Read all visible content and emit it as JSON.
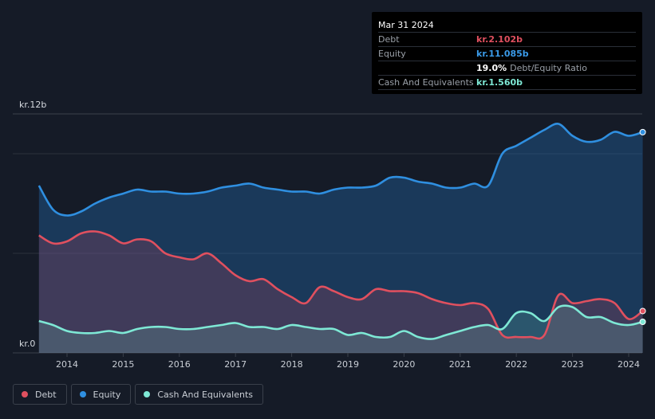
{
  "tooltip": {
    "date": "Mar 31 2024",
    "debt_label": "Debt",
    "debt_value": "kr.2.102b",
    "equity_label": "Equity",
    "equity_value": "kr.11.085b",
    "ratio_value": "19.0%",
    "ratio_label": "Debt/Equity Ratio",
    "cash_label": "Cash And Equivalents",
    "cash_value": "kr.1.560b"
  },
  "legend": {
    "debt": "Debt",
    "equity": "Equity",
    "cash": "Cash And Equivalents"
  },
  "colors": {
    "debt": "#e0505f",
    "equity": "#2f8fe0",
    "cash": "#7ee8d5",
    "background": "#151b27"
  },
  "chart_data": {
    "type": "area",
    "ylim": [
      0,
      12
    ],
    "xlim": [
      2013.5,
      2024.25
    ],
    "y_tick_labels": [
      {
        "value": 12,
        "label": "kr.12b"
      },
      {
        "value": 0,
        "label": "kr.0"
      }
    ],
    "x_ticks": [
      2014,
      2015,
      2016,
      2017,
      2018,
      2019,
      2020,
      2021,
      2022,
      2023,
      2024
    ],
    "x_tick_labels": [
      "2014",
      "2015",
      "2016",
      "2017",
      "2018",
      "2019",
      "2020",
      "2021",
      "2022",
      "2023",
      "2024"
    ],
    "series": [
      {
        "name": "Equity",
        "key": "equity",
        "x": [
          2013.5,
          2013.75,
          2014.0,
          2014.25,
          2014.5,
          2014.75,
          2015.0,
          2015.25,
          2015.5,
          2015.75,
          2016.0,
          2016.25,
          2016.5,
          2016.75,
          2017.0,
          2017.25,
          2017.5,
          2017.75,
          2018.0,
          2018.25,
          2018.5,
          2018.75,
          2019.0,
          2019.25,
          2019.5,
          2019.75,
          2020.0,
          2020.25,
          2020.5,
          2020.75,
          2021.0,
          2021.25,
          2021.5,
          2021.75,
          2022.0,
          2022.25,
          2022.5,
          2022.75,
          2023.0,
          2023.25,
          2023.5,
          2023.75,
          2024.0,
          2024.25
        ],
        "values": [
          8.4,
          7.2,
          6.9,
          7.1,
          7.5,
          7.8,
          8.0,
          8.2,
          8.1,
          8.1,
          8.0,
          8.0,
          8.1,
          8.3,
          8.4,
          8.5,
          8.3,
          8.2,
          8.1,
          8.1,
          8.0,
          8.2,
          8.3,
          8.3,
          8.4,
          8.8,
          8.8,
          8.6,
          8.5,
          8.3,
          8.3,
          8.5,
          8.4,
          10.0,
          10.4,
          10.8,
          11.2,
          11.5,
          10.9,
          10.6,
          10.7,
          11.1,
          10.9,
          11.085
        ]
      },
      {
        "name": "Debt",
        "key": "debt",
        "x": [
          2013.5,
          2013.75,
          2014.0,
          2014.25,
          2014.5,
          2014.75,
          2015.0,
          2015.25,
          2015.5,
          2015.75,
          2016.0,
          2016.25,
          2016.5,
          2016.75,
          2017.0,
          2017.25,
          2017.5,
          2017.75,
          2018.0,
          2018.25,
          2018.5,
          2018.75,
          2019.0,
          2019.25,
          2019.5,
          2019.75,
          2020.0,
          2020.25,
          2020.5,
          2020.75,
          2021.0,
          2021.25,
          2021.5,
          2021.75,
          2022.0,
          2022.25,
          2022.5,
          2022.75,
          2023.0,
          2023.25,
          2023.5,
          2023.75,
          2024.0,
          2024.25
        ],
        "values": [
          5.9,
          5.5,
          5.6,
          6.0,
          6.1,
          5.9,
          5.5,
          5.7,
          5.6,
          5.0,
          4.8,
          4.7,
          5.0,
          4.5,
          3.9,
          3.6,
          3.7,
          3.2,
          2.8,
          2.5,
          3.3,
          3.1,
          2.8,
          2.7,
          3.2,
          3.1,
          3.1,
          3.0,
          2.7,
          2.5,
          2.4,
          2.5,
          2.2,
          0.9,
          0.8,
          0.8,
          0.9,
          2.9,
          2.5,
          2.6,
          2.7,
          2.5,
          1.7,
          2.102
        ]
      },
      {
        "name": "Cash And Equivalents",
        "key": "cash",
        "x": [
          2013.5,
          2013.75,
          2014.0,
          2014.25,
          2014.5,
          2014.75,
          2015.0,
          2015.25,
          2015.5,
          2015.75,
          2016.0,
          2016.25,
          2016.5,
          2016.75,
          2017.0,
          2017.25,
          2017.5,
          2017.75,
          2018.0,
          2018.25,
          2018.5,
          2018.75,
          2019.0,
          2019.25,
          2019.5,
          2019.75,
          2020.0,
          2020.25,
          2020.5,
          2020.75,
          2021.0,
          2021.25,
          2021.5,
          2021.75,
          2022.0,
          2022.25,
          2022.5,
          2022.75,
          2023.0,
          2023.25,
          2023.5,
          2023.75,
          2024.0,
          2024.25
        ],
        "values": [
          1.6,
          1.4,
          1.1,
          1.0,
          1.0,
          1.1,
          1.0,
          1.2,
          1.3,
          1.3,
          1.2,
          1.2,
          1.3,
          1.4,
          1.5,
          1.3,
          1.3,
          1.2,
          1.4,
          1.3,
          1.2,
          1.2,
          0.9,
          1.0,
          0.8,
          0.8,
          1.1,
          0.8,
          0.7,
          0.9,
          1.1,
          1.3,
          1.4,
          1.2,
          2.0,
          2.0,
          1.6,
          2.3,
          2.3,
          1.8,
          1.8,
          1.5,
          1.4,
          1.56
        ]
      }
    ]
  }
}
